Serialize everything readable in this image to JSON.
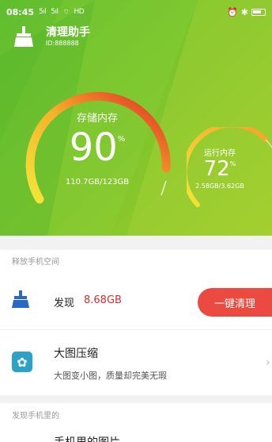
{
  "status_bar": {
    "time": "08:45",
    "signal1": "5ıl",
    "signal2": "5ıl",
    "network": "HD"
  },
  "app": {
    "title": "清理助手",
    "id_text": "ID:888888"
  },
  "storage": {
    "title": "存储内存",
    "percent": "90",
    "percent_sign": "%",
    "usage": "110.7GB/123GB",
    "level": 0.9
  },
  "memory": {
    "title": "运行内存",
    "percent": "72",
    "percent_sign": "%",
    "usage": "2.58GB/3.62GB",
    "level": 0.72
  },
  "section1": {
    "header": "释放手机空间"
  },
  "junk": {
    "label": "发现",
    "size": "8.68GB",
    "button": "一键清理"
  },
  "compress": {
    "title": "大图压缩",
    "subtitle": "大图变小图，质量却完美无瑕"
  },
  "section2": {
    "header": "发现手机里的",
    "next_title": "手机里的图片"
  },
  "colors": {
    "green": "#6cc02c",
    "accent_red": "#ea4a3f",
    "junk_size": "#d0312d",
    "cyan": "#2aa3c6"
  }
}
